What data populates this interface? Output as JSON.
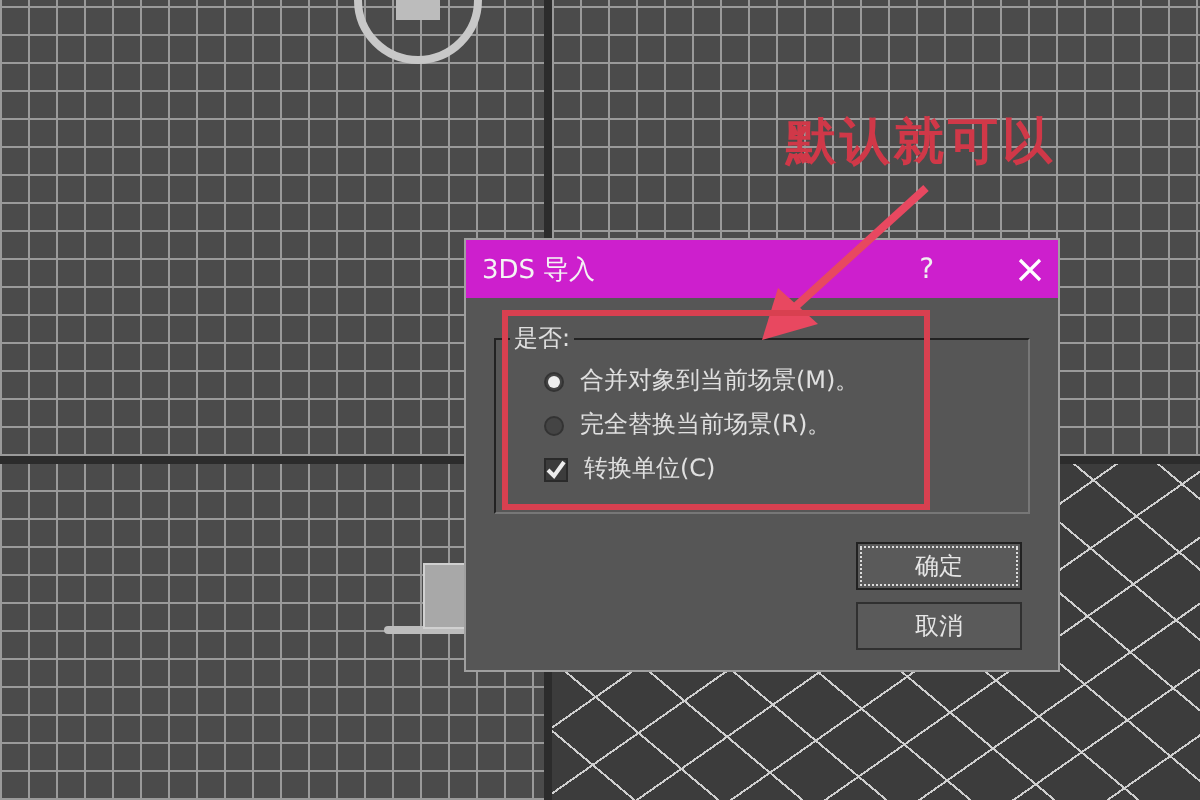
{
  "annotation": {
    "text": "默认就可以"
  },
  "dialog": {
    "title": "3DS 导入",
    "help": "?",
    "group_label": "是否:",
    "options": [
      {
        "kind": "radio",
        "label": "合并对象到当前场景(M)。",
        "selected": true
      },
      {
        "kind": "radio",
        "label": "完全替换当前场景(R)。",
        "selected": false
      },
      {
        "kind": "checkbox",
        "label": "转换单位(C)",
        "checked": true
      }
    ],
    "buttons": [
      {
        "label": "确定",
        "default": true
      },
      {
        "label": "取消",
        "default": false
      }
    ]
  }
}
